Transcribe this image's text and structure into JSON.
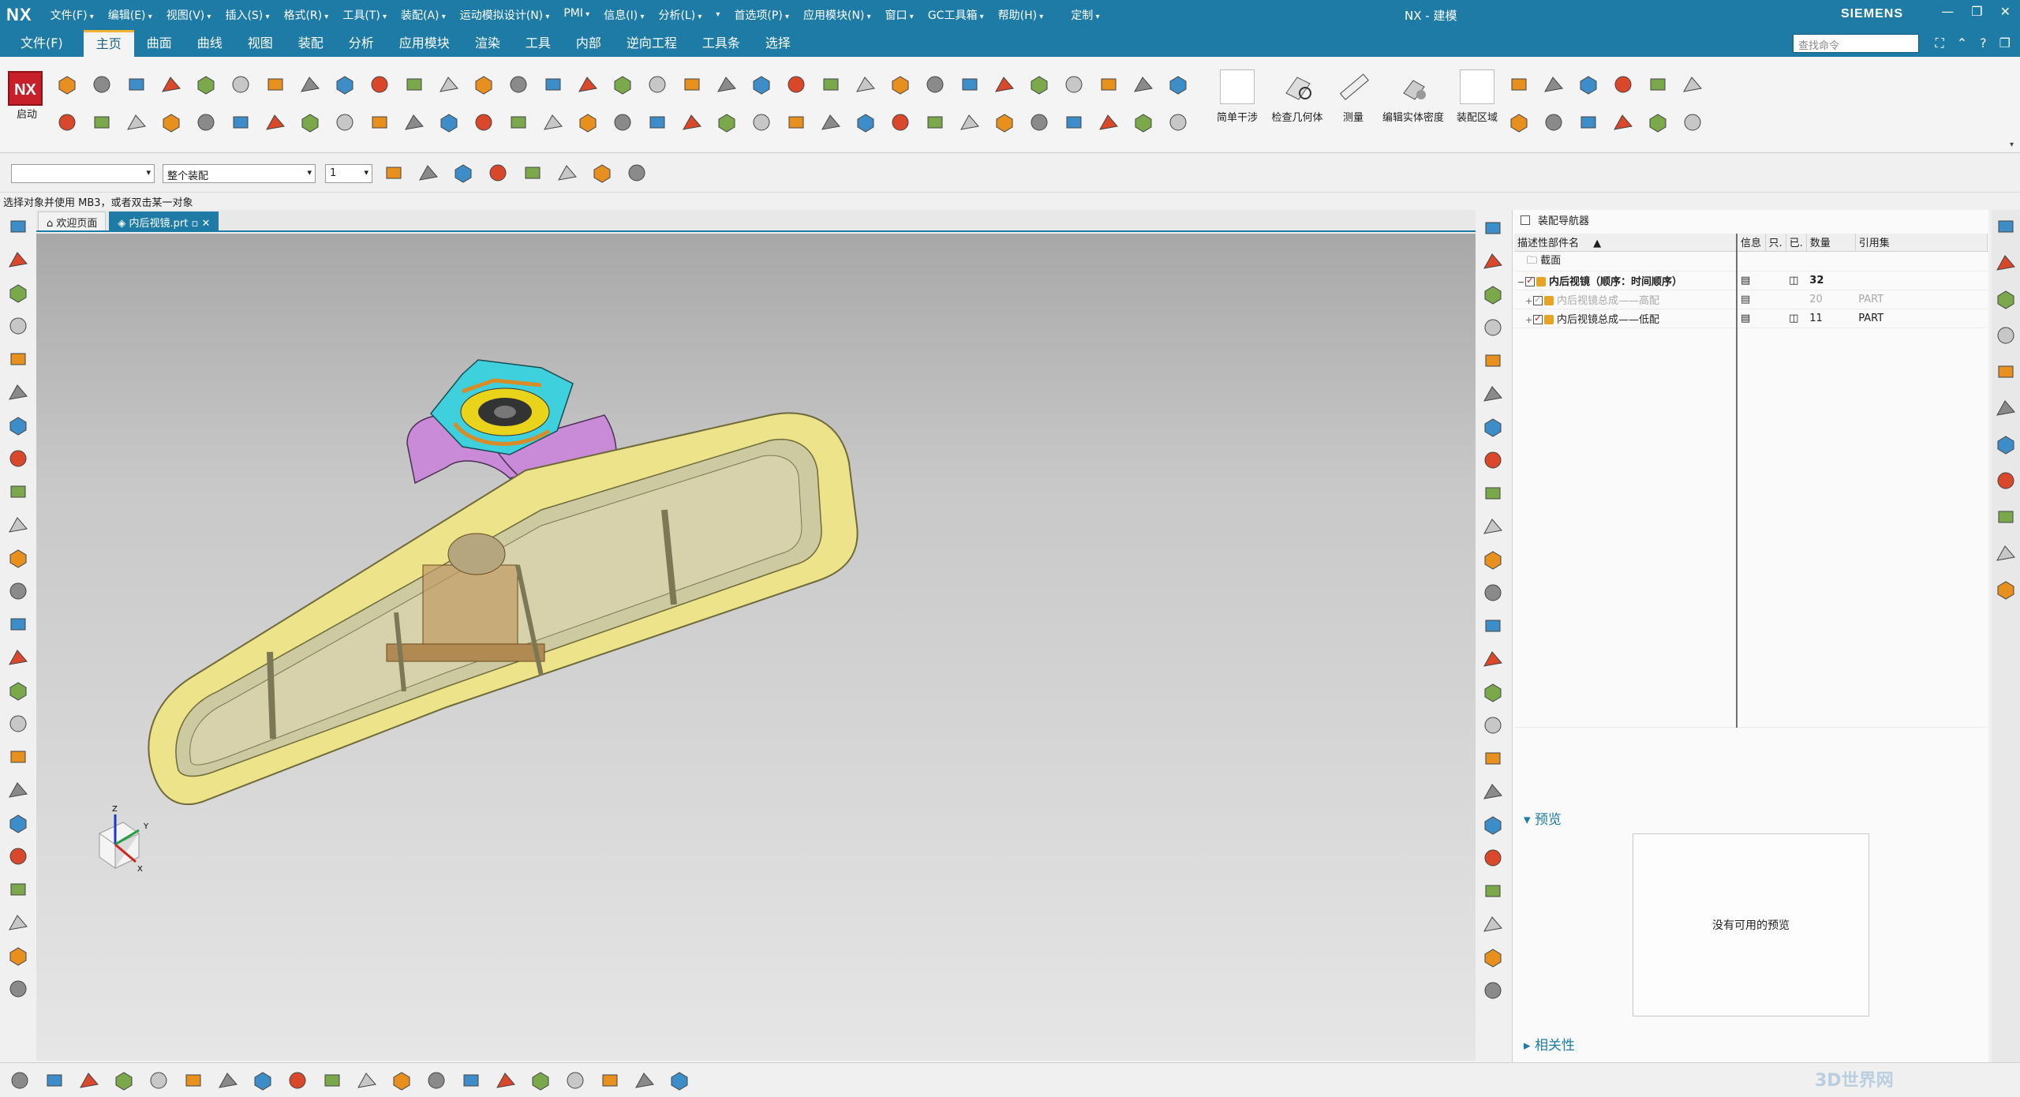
{
  "titlebar": {
    "logo": "NX",
    "menus": [
      "文件(F)",
      "编辑(E)",
      "视图(V)",
      "插入(S)",
      "格式(R)",
      "工具(T)",
      "装配(A)",
      "运动模拟设计(N)",
      "PMI",
      "信息(I)",
      "分析(L)",
      "",
      "首选项(P)",
      "应用模块(N)",
      "窗口",
      "GC工具箱",
      "帮助(H)",
      "定制"
    ],
    "title": "NX - 建模",
    "brand": "SIEMENS",
    "window_buttons": [
      "—",
      "❐",
      "✕"
    ]
  },
  "ribbon_tabs": {
    "file": "文件(F)",
    "tabs": [
      "主页",
      "曲面",
      "曲线",
      "视图",
      "装配",
      "分析",
      "应用模块",
      "渲染",
      "工具",
      "内部",
      "逆向工程",
      "工具条",
      "选择"
    ],
    "active": "主页",
    "search_placeholder": "查找命令"
  },
  "ribbon": {
    "start_label": "启动",
    "big_buttons": [
      "简单干涉",
      "检查几何体",
      "测量",
      "编辑实体密度",
      "装配区域"
    ]
  },
  "selbar": {
    "filter": "",
    "scope": "整个装配",
    "level": "1"
  },
  "status": "选择对象并使用 MB3，或者双击某一对象",
  "doctabs": {
    "welcome": "欢迎页面",
    "part": "内后视镜.prt"
  },
  "navigator": {
    "title": "装配导航器",
    "columns": [
      "描述性部件名",
      "信息",
      "只.",
      "已.",
      "数量",
      "引用集"
    ],
    "rows": [
      {
        "name": "截面",
        "qty": "",
        "ref": ""
      },
      {
        "name": "内后视镜（顺序：时间顺序）",
        "qty": "32",
        "ref": ""
      },
      {
        "name": "内后视镜总成——高配",
        "qty": "20",
        "ref": "PART"
      },
      {
        "name": "内后视镜总成——低配",
        "qty": "11",
        "ref": "PART"
      }
    ],
    "preview_title": "预览",
    "preview_empty": "没有可用的预览",
    "properties_title": "相关性"
  },
  "triad": {
    "x": "X",
    "y": "Y",
    "z": "Z"
  },
  "watermark": "3D世界网",
  "colors": {
    "titlebar": "#1e7ba6",
    "accent": "#f3b233",
    "frame_yellow": "#ede38a",
    "bracket_cyan": "#3ed0dc",
    "clip_purple": "#c98ad8"
  }
}
